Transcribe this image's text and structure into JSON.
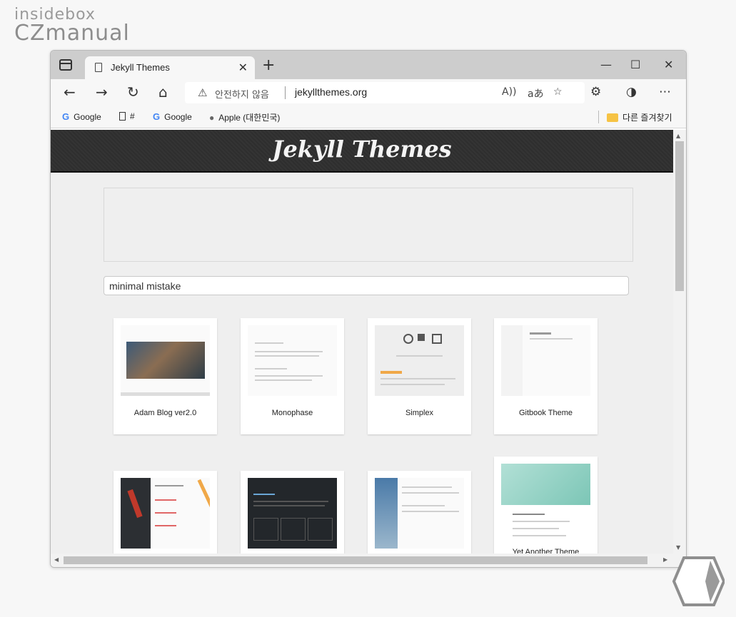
{
  "brand": {
    "line1": "insidebox",
    "line2": "CZmanual"
  },
  "browser": {
    "tab_title": "Jekyll Themes",
    "tab_close": "✕",
    "new_tab": "+",
    "window_controls": {
      "minimize": "—",
      "maximize": "☐",
      "close": "✕"
    },
    "nav": {
      "back": "←",
      "forward": "→",
      "reload": "↻",
      "home": "⌂"
    },
    "address": {
      "security_label": "안전하지 않음",
      "url": "jekyllthemes.org",
      "read_aloud": "A))",
      "translate": "aあ"
    },
    "bookmarks": [
      {
        "label": "Google",
        "icon": "google-icon"
      },
      {
        "label": "#",
        "icon": "page-icon"
      },
      {
        "label": "Google",
        "icon": "google-icon"
      },
      {
        "label": "Apple (대한민국)",
        "icon": "apple-icon"
      }
    ],
    "other_favorites": "다른 즐겨찾기"
  },
  "site": {
    "title": "Jekyll Themes",
    "search_value": "minimal mistake",
    "themes": [
      {
        "name": "Adam Blog ver2.0"
      },
      {
        "name": "Monophase"
      },
      {
        "name": "Simplex"
      },
      {
        "name": "Gitbook Theme"
      },
      {
        "name": ""
      },
      {
        "name": ""
      },
      {
        "name": ""
      },
      {
        "name": "Yet Another Theme"
      }
    ]
  }
}
